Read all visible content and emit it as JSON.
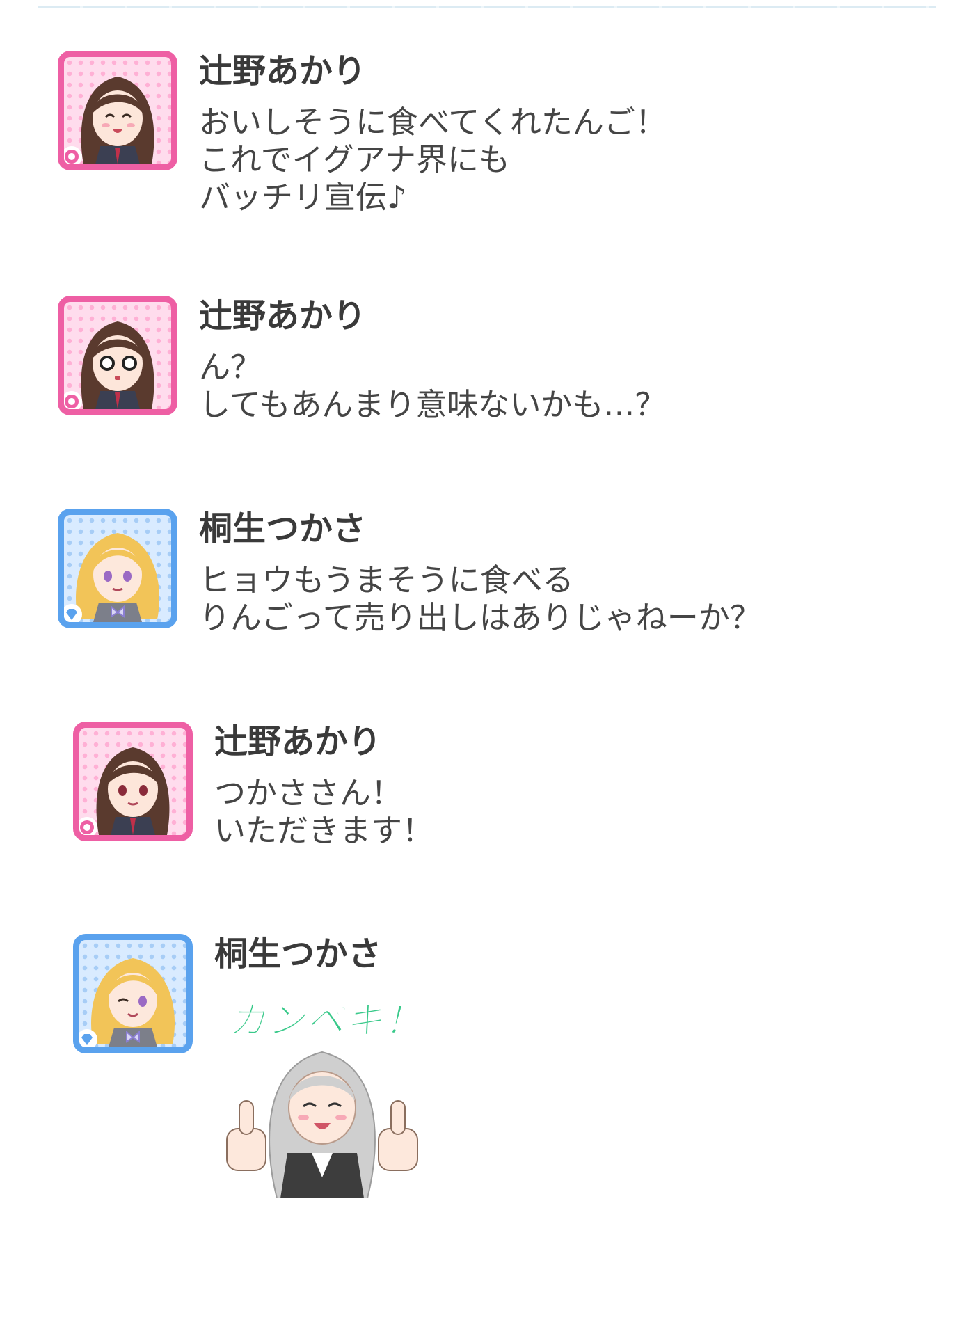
{
  "messages": [
    {
      "speaker": "辻野あかり",
      "text": "おいしそうに食べてくれたんご！\nこれでイグアナ界にも\nバッチリ宣伝♪",
      "avatar": "akari-smiling-portrait",
      "badge": "cute-flower-icon"
    },
    {
      "speaker": "辻野あかり",
      "text": "ん？\nしてもあんまり意味ないかも…？",
      "avatar": "akari-surprised-portrait",
      "badge": "cute-flower-icon"
    },
    {
      "speaker": "桐生つかさ",
      "text": "ヒョウもうまそうに食べる\nりんごって売り出しはありじゃねーか？",
      "avatar": "tsukasa-smiling-portrait",
      "badge": "cool-diamond-icon"
    },
    {
      "speaker": "辻野あかり",
      "text": "つかささん！\nいただきます！",
      "avatar": "akari-neutral-portrait",
      "badge": "cute-flower-icon"
    },
    {
      "speaker": "桐生つかさ",
      "sticker_text": "カンペキ！",
      "avatar": "tsukasa-winking-portrait",
      "badge": "cool-diamond-icon"
    }
  ],
  "colors": {
    "pink_frame": "#ee5fa4",
    "blue_frame": "#5aa2ee",
    "sticker_green": "#39c98a"
  }
}
